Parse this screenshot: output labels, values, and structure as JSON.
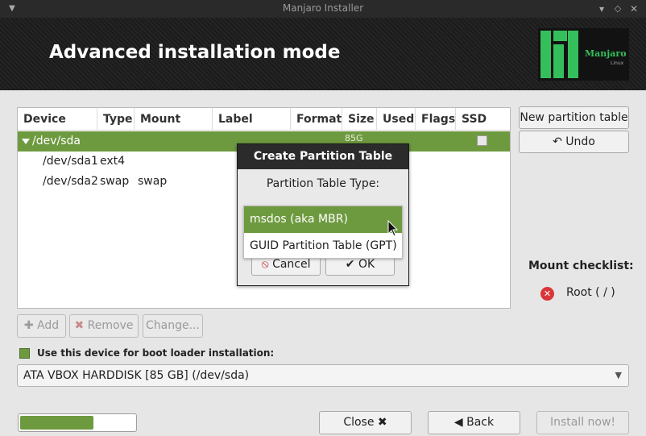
{
  "window": {
    "title": "Manjaro Installer"
  },
  "header": {
    "title": "Advanced installation mode",
    "logo_text": "Manjaro",
    "logo_subtext": "Linux"
  },
  "table": {
    "columns": [
      "Device",
      "Type",
      "Mount point",
      "Label",
      "Format",
      "Size",
      "Used",
      "Flags",
      "SSD"
    ],
    "rows": [
      {
        "device": "/dev/sda",
        "type": "",
        "mount": "",
        "size": "85G",
        "selected": true
      },
      {
        "device": "/dev/sda1",
        "type": "ext4",
        "mount": ""
      },
      {
        "device": "/dev/sda2",
        "type": "swap",
        "mount": "swap"
      }
    ]
  },
  "buttons": {
    "new_partition_table": "New partition table",
    "undo": "Undo",
    "add": "Add",
    "remove": "Remove",
    "change": "Change...",
    "close": "Close",
    "back": "Back",
    "install": "Install now!"
  },
  "dialog": {
    "title": "Create Partition Table",
    "label": "Partition Table Type:",
    "options": [
      "msdos (aka MBR)",
      "GUID Partition Table (GPT)"
    ],
    "cancel": "Cancel",
    "ok": "OK"
  },
  "bootloader": {
    "checkbox_label": "Use this device for boot loader installation:",
    "device": "ATA VBOX HARDDISK [85 GB] (/dev/sda)"
  },
  "mount_checklist": {
    "title": "Mount checklist:",
    "items": [
      {
        "label": "Root ( / )"
      }
    ]
  },
  "progress": {
    "value": 0.64
  },
  "colors": {
    "accent": "#6e9a3f",
    "header_bg": "#1f1f1f",
    "error": "#d9363a"
  }
}
